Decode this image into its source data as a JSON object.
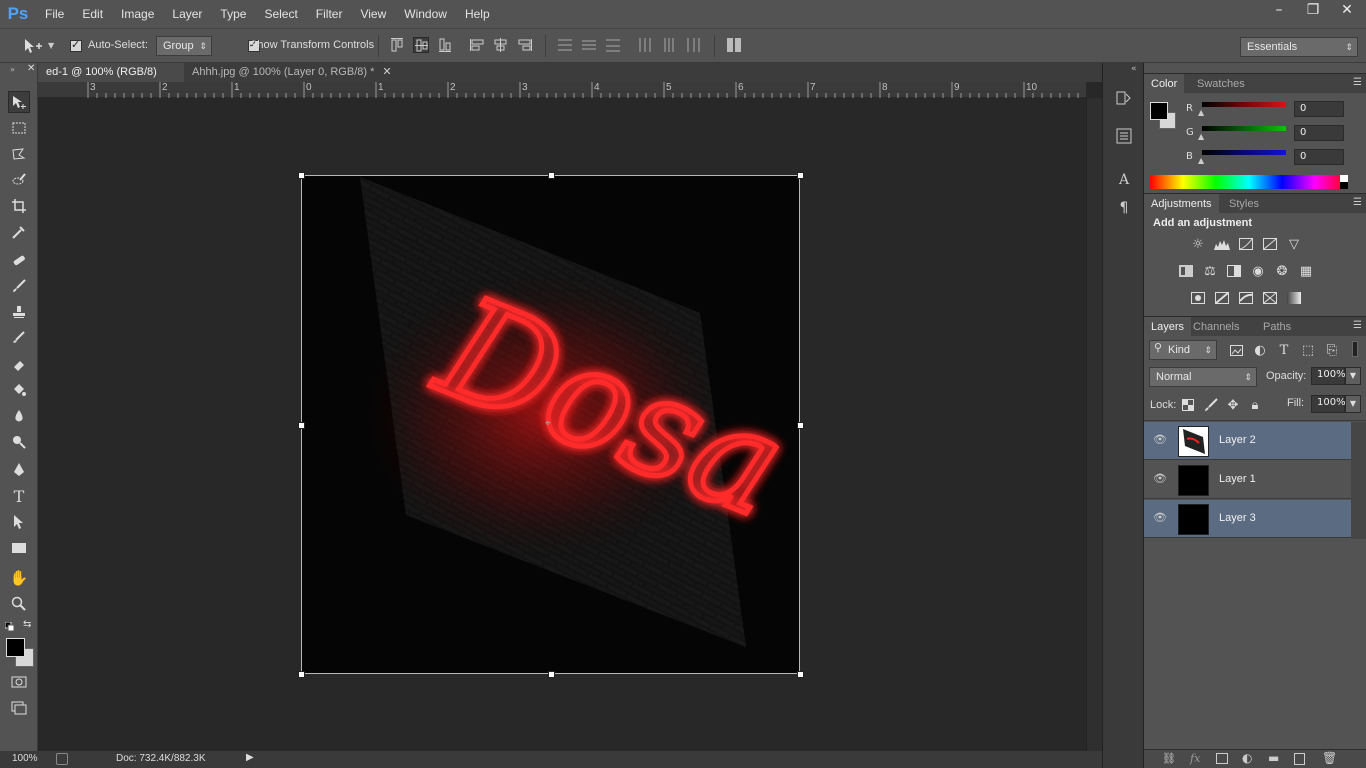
{
  "app": {
    "logo": "Ps",
    "menu": [
      "File",
      "Edit",
      "Image",
      "Layer",
      "Type",
      "Select",
      "Filter",
      "View",
      "Window",
      "Help"
    ],
    "window_controls": {
      "minimize": "–",
      "restore": "❐",
      "close": "✕"
    }
  },
  "options_bar": {
    "auto_select_label": "Auto-Select:",
    "auto_select_value": "Group",
    "transform_controls_label": "Show Transform Controls",
    "workspace": "Essentials"
  },
  "tabs": [
    {
      "label": "ed-1 @ 100% (RGB/8) *",
      "active": true,
      "close": "✕"
    },
    {
      "label": "Ahhh.jpg @ 100% (Layer 0, RGB/8) *",
      "active": false,
      "close": "✕"
    }
  ],
  "ruler": {
    "ticks": [
      "3",
      "2",
      "1",
      "0",
      "1",
      "2",
      "3",
      "4",
      "5",
      "6",
      "7",
      "8",
      "9",
      "10"
    ]
  },
  "canvas": {
    "text": "Dosa"
  },
  "status": {
    "zoom": "100%",
    "doc": "Doc: 732.4K/882.3K"
  },
  "color_panel": {
    "tabs": [
      "Color",
      "Swatches"
    ],
    "channels": [
      {
        "label": "R",
        "value": "0",
        "color": "#e01010"
      },
      {
        "label": "G",
        "value": "0",
        "color": "#10c010"
      },
      {
        "label": "B",
        "value": "0",
        "color": "#1010e0"
      }
    ]
  },
  "adjustments_panel": {
    "tabs": [
      "Adjustments",
      "Styles"
    ],
    "heading": "Add an adjustment"
  },
  "layers_panel": {
    "tabs": [
      "Layers",
      "Channels",
      "Paths"
    ],
    "filter_kind": "Kind",
    "blend_mode": "Normal",
    "opacity_label": "Opacity:",
    "opacity_value": "100%",
    "lock_label": "Lock:",
    "fill_label": "Fill:",
    "fill_value": "100%",
    "layers": [
      {
        "name": "Layer 2",
        "selected": true
      },
      {
        "name": "Layer 1",
        "selected": false
      },
      {
        "name": "Layer 3",
        "selected": true
      }
    ]
  }
}
